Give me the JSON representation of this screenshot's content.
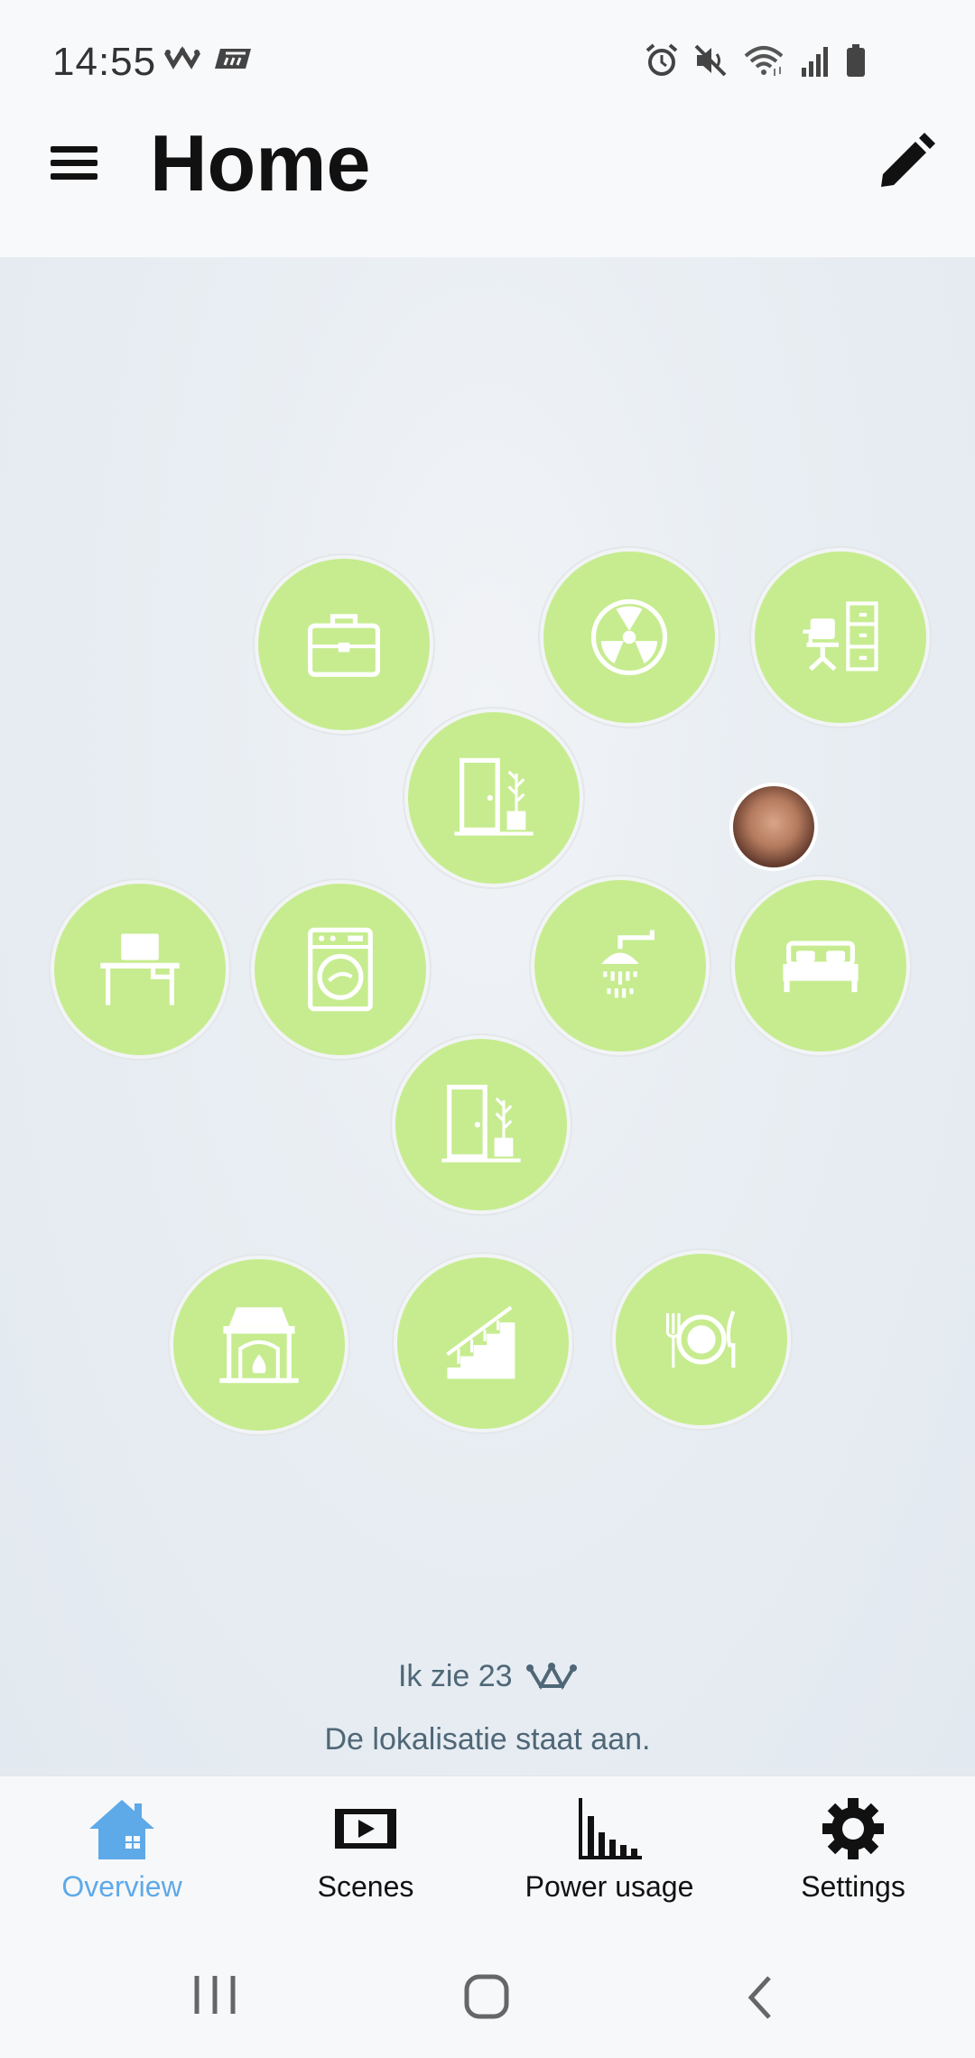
{
  "status_bar": {
    "time": "14:55",
    "left_icons": [
      "crown-app-icon",
      "app-badge-icon"
    ],
    "right_icons": [
      "alarm-icon",
      "mute-icon",
      "wifi-icon",
      "signal-icon",
      "battery-icon"
    ]
  },
  "header": {
    "title": "Home",
    "menu_icon": "hamburger-icon",
    "edit_icon": "pencil-icon"
  },
  "rooms": [
    {
      "name": "office-briefcase",
      "icon": "briefcase-icon"
    },
    {
      "name": "radiation",
      "icon": "radiation-icon"
    },
    {
      "name": "desk-cabinet",
      "icon": "desk-chair-icon"
    },
    {
      "name": "hallway-upper",
      "icon": "door-plant-icon"
    },
    {
      "name": "desk",
      "icon": "desk-computer-icon"
    },
    {
      "name": "laundry",
      "icon": "washing-machine-icon"
    },
    {
      "name": "bathroom",
      "icon": "shower-icon"
    },
    {
      "name": "bedroom",
      "icon": "bed-icon"
    },
    {
      "name": "hallway-lower",
      "icon": "door-plant-icon"
    },
    {
      "name": "living-room",
      "icon": "fireplace-icon"
    },
    {
      "name": "stairs",
      "icon": "stairs-icon"
    },
    {
      "name": "dining",
      "icon": "dining-plate-icon"
    }
  ],
  "info": {
    "count_text": "Ik zie 23",
    "location_text": "De lokalisatie staat aan."
  },
  "bottom_nav": [
    {
      "label": "Overview",
      "icon": "home-icon",
      "active": true
    },
    {
      "label": "Scenes",
      "icon": "scenes-icon",
      "active": false
    },
    {
      "label": "Power usage",
      "icon": "bar-chart-icon",
      "active": false
    },
    {
      "label": "Settings",
      "icon": "gear-icon",
      "active": false
    }
  ],
  "system_nav": [
    "recents-icon",
    "home-circle-icon",
    "back-icon"
  ],
  "colors": {
    "room_fill": "#c6ec8f",
    "active_nav": "#5ea9e8",
    "info_text": "#4f6777"
  }
}
